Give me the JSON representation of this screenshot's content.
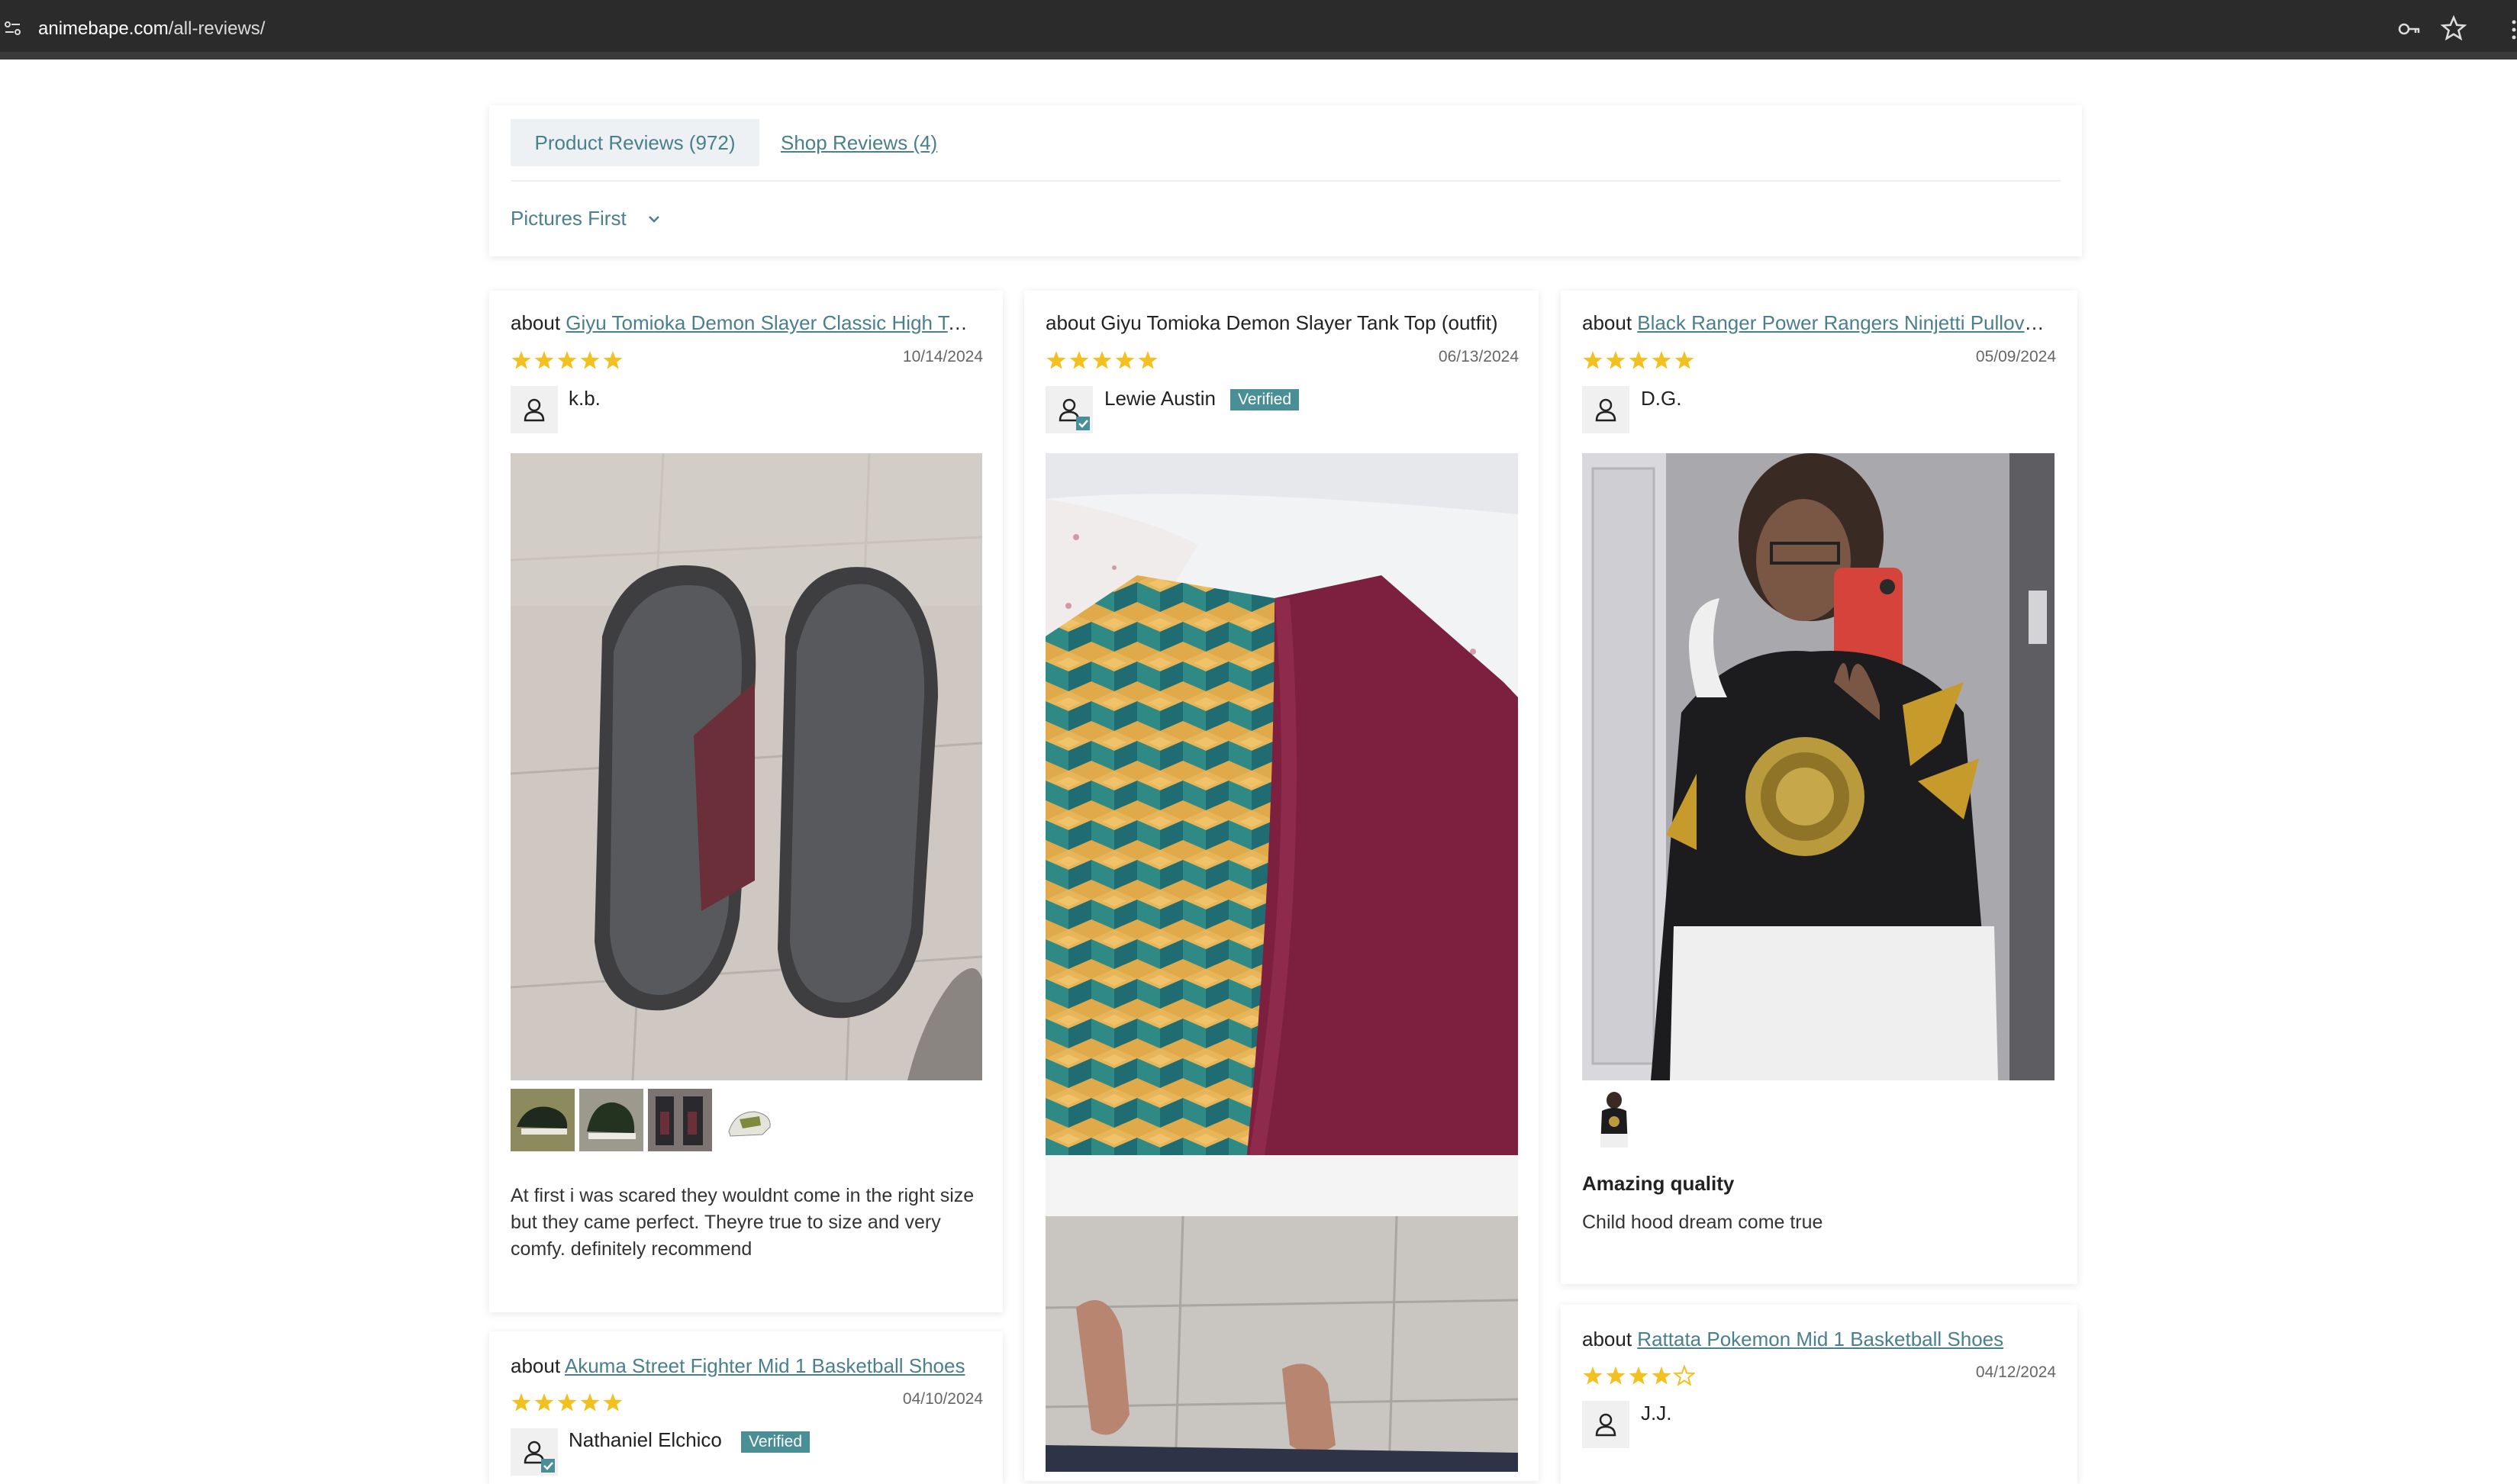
{
  "browser": {
    "url_host": "animebape.com",
    "url_path": "/all-reviews/"
  },
  "tabs": {
    "product_label": "Product Reviews (972)",
    "shop_label": "Shop Reviews (4)"
  },
  "sort": {
    "selected": "Pictures First"
  },
  "colors": {
    "accent": "#4a7f8c",
    "star": "#f2c11f",
    "verified_badge": "#4a8f95"
  },
  "reviews": [
    {
      "about_prefix": "about ",
      "product": "Giyu Tomioka Demon Slayer Classic High Top Canvas Shoes",
      "product_is_link": true,
      "rating": 5,
      "date": "10/14/2024",
      "author": "k.b.",
      "verified": false,
      "body": "At first i was scared they wouldnt come in the right size but they came perfect. Theyre true to size and very comfy. definitely recommend"
    },
    {
      "about_prefix": "about ",
      "product": "Giyu Tomioka Demon Slayer Tank Top (outfit)",
      "product_is_link": false,
      "rating": 5,
      "date": "06/13/2024",
      "author": "Lewie Austin",
      "verified": true,
      "verified_label": "Verified"
    },
    {
      "about_prefix": "about ",
      "product": "Black Ranger Power Rangers Ninjetti Pullover Hoodie",
      "product_is_link": true,
      "rating": 5,
      "date": "05/09/2024",
      "author": "D.G.",
      "verified": false,
      "title": "Amazing quality",
      "body": "Child hood dream come true"
    },
    {
      "about_prefix": "about ",
      "product": "Akuma Street Fighter Mid 1 Basketball Shoes",
      "product_is_link": true,
      "rating": 5,
      "date": "04/10/2024",
      "author": "Nathaniel Elchico",
      "verified": true,
      "verified_label": "Verified"
    },
    {
      "about_prefix": "about ",
      "product": "Rattata Pokemon Mid 1 Basketball Shoes",
      "product_is_link": true,
      "rating": 4,
      "date": "04/12/2024",
      "author": "J.J.",
      "verified": false
    }
  ],
  "icons": {
    "site_info": "site-info-icon",
    "password_key": "key-icon",
    "bookmark": "star-outline-icon",
    "chevron": "chevron-down-icon",
    "user": "user-icon",
    "verified_check": "check-icon"
  }
}
